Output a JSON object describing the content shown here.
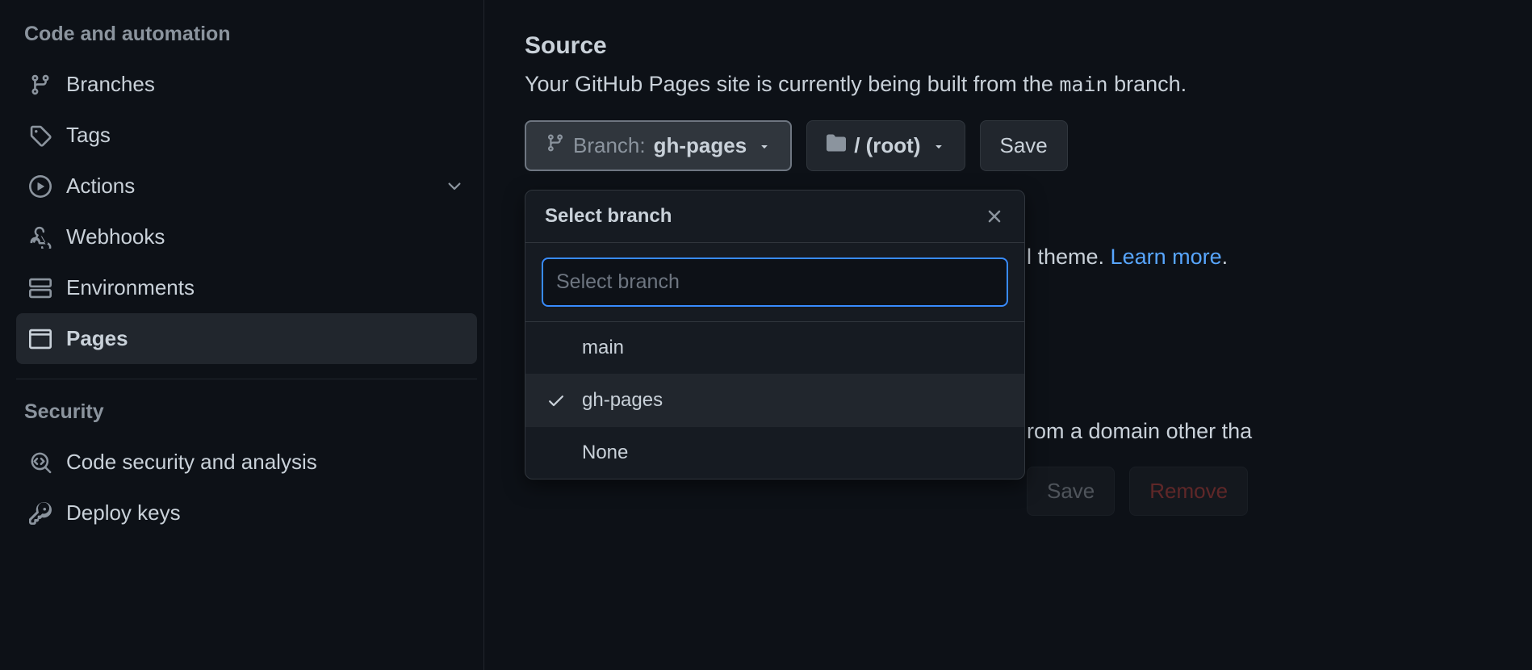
{
  "sidebar": {
    "section_code_title": "Code and automation",
    "items": [
      {
        "label": "Branches",
        "icon": "branch"
      },
      {
        "label": "Tags",
        "icon": "tag"
      },
      {
        "label": "Actions",
        "icon": "play",
        "has_chevron": true
      },
      {
        "label": "Webhooks",
        "icon": "webhook"
      },
      {
        "label": "Environments",
        "icon": "server"
      },
      {
        "label": "Pages",
        "icon": "browser",
        "active": true
      }
    ],
    "section_security_title": "Security",
    "security_items": [
      {
        "label": "Code security and analysis",
        "icon": "codescan"
      },
      {
        "label": "Deploy keys",
        "icon": "key"
      }
    ]
  },
  "main": {
    "source": {
      "heading": "Source",
      "desc_prefix": "Your GitHub Pages site is currently being built from the ",
      "desc_code": "main",
      "desc_suffix": " branch."
    },
    "branch_button": {
      "prefix": "Branch:",
      "value": "gh-pages"
    },
    "folder_button": {
      "value": "/ (root)"
    },
    "save_button": "Save",
    "bg_line1_suffix": "l theme. ",
    "bg_line1_link": "Learn more",
    "bg_line2_suffix": "rom a domain other tha",
    "bg_save": "Save",
    "bg_remove": "Remove"
  },
  "dropdown": {
    "title": "Select branch",
    "placeholder": "Select branch",
    "items": [
      {
        "label": "main",
        "selected": false
      },
      {
        "label": "gh-pages",
        "selected": true
      },
      {
        "label": "None",
        "selected": false
      }
    ]
  }
}
